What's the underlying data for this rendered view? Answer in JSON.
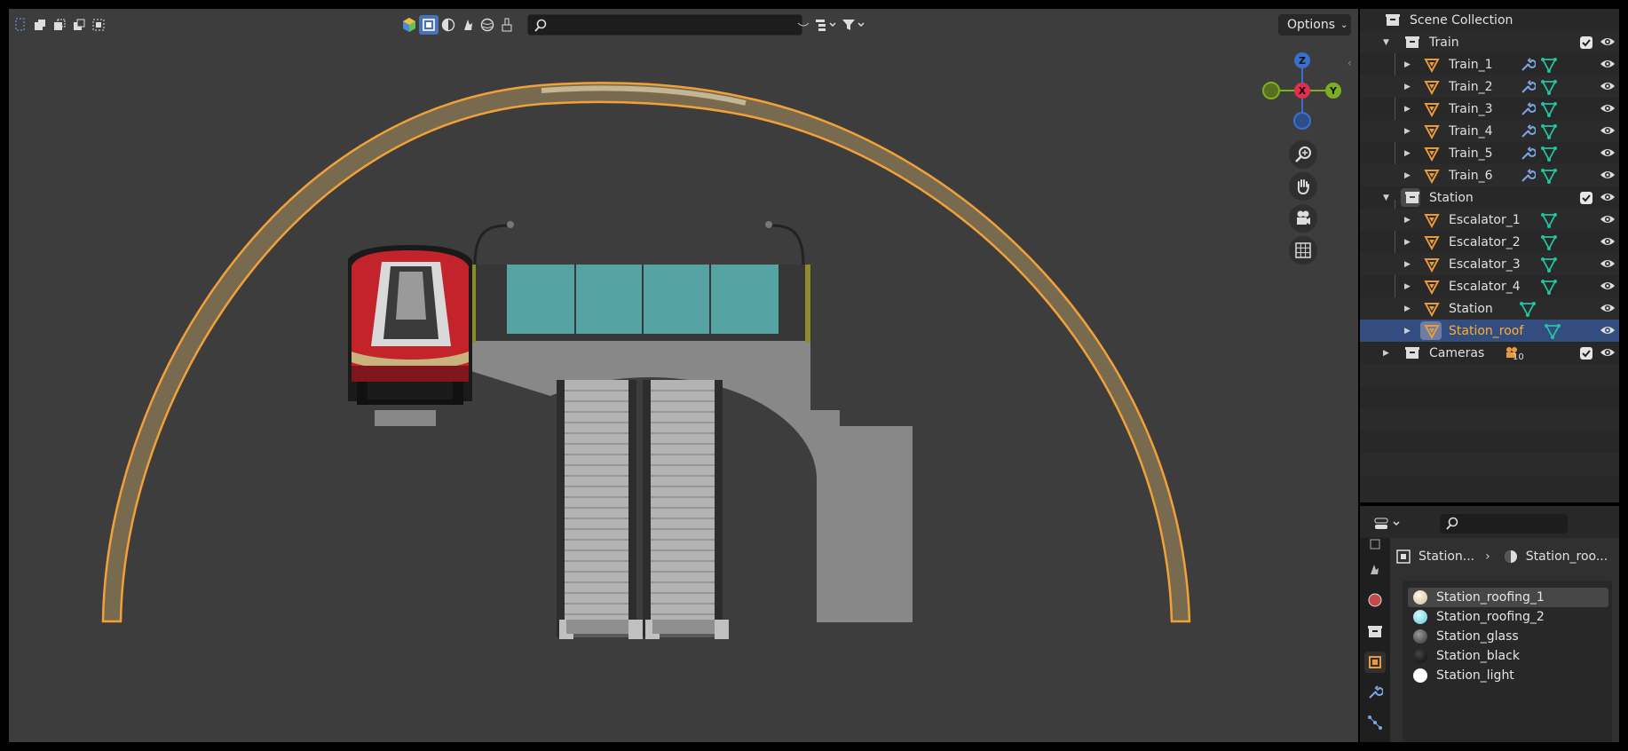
{
  "viewport": {
    "header": {
      "select_mode_icons": [
        "select-box-icon",
        "select-new-icon",
        "select-extend-icon",
        "select-subtract-icon",
        "select-intersect-icon"
      ],
      "shading_icons": [
        "material-preview-sphere-icon",
        "wireframe-icon",
        "solid-icon",
        "material-preview-icon",
        "rendered-icon",
        "brush-icon"
      ],
      "search_placeholder": "",
      "options_label": "Options"
    },
    "gizmo": {
      "x_label": "X",
      "y_label": "Y",
      "z_label": "Z"
    },
    "colors": {
      "background": "#3d3d3d",
      "selection_outline": "#f2a13a",
      "train_red": "#c3232b",
      "glass": "#55a3a5",
      "concrete": "#8a8a8a"
    }
  },
  "outliner": {
    "root": "Scene Collection",
    "collections": [
      {
        "name": "Train",
        "checked": true,
        "children": [
          {
            "name": "Train_1",
            "modifier": true
          },
          {
            "name": "Train_2",
            "modifier": true
          },
          {
            "name": "Train_3",
            "modifier": true
          },
          {
            "name": "Train_4",
            "modifier": true
          },
          {
            "name": "Train_5",
            "modifier": true
          },
          {
            "name": "Train_6",
            "modifier": true
          }
        ]
      },
      {
        "name": "Station",
        "checked": true,
        "children": [
          {
            "name": "Escalator_1",
            "modifier": false
          },
          {
            "name": "Escalator_2",
            "modifier": false
          },
          {
            "name": "Escalator_3",
            "modifier": false
          },
          {
            "name": "Escalator_4",
            "modifier": false
          },
          {
            "name": "Station",
            "modifier": false
          },
          {
            "name": "Station_roof",
            "modifier": false,
            "selected": true
          }
        ]
      },
      {
        "name": "Cameras",
        "checked": true,
        "camera_count": "10"
      }
    ]
  },
  "properties": {
    "search_placeholder": "",
    "breadcrumb": {
      "object": "Station...",
      "material": "Station_roo..."
    },
    "materials": [
      {
        "name": "Station_roofing_1",
        "color": "#e8dfc0",
        "selected": true
      },
      {
        "name": "Station_roofing_2",
        "color": "#8fe3ea",
        "selected": false
      },
      {
        "name": "Station_glass",
        "color": "#666666",
        "selected": false
      },
      {
        "name": "Station_black",
        "color": "#111111",
        "selected": false
      },
      {
        "name": "Station_light",
        "color": "#ffffff",
        "selected": false
      }
    ]
  }
}
